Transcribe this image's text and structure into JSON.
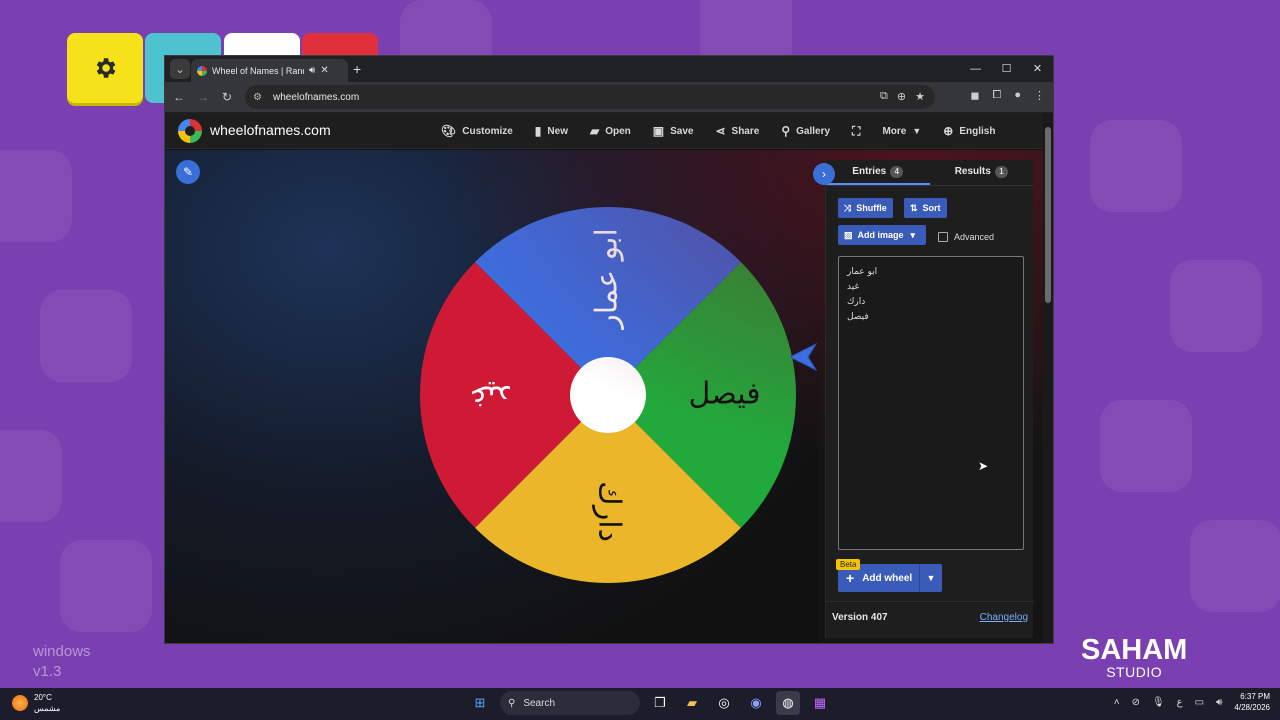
{
  "desktop": {
    "watermark_line1": "windows",
    "watermark_line2": "v1.3",
    "brand_title": "SAHAM",
    "brand_sub": "STUDIO"
  },
  "browser": {
    "tab_title": "Wheel of Names | Random",
    "url": "wheelofnames.com"
  },
  "site": {
    "logo_text": "wheelofnames.com",
    "nav": [
      {
        "label": "Customize",
        "icon": "palette-icon"
      },
      {
        "label": "New",
        "icon": "file-icon"
      },
      {
        "label": "Open",
        "icon": "folder-icon"
      },
      {
        "label": "Save",
        "icon": "save-icon"
      },
      {
        "label": "Share",
        "icon": "share-icon"
      },
      {
        "label": "Gallery",
        "icon": "search-icon"
      },
      {
        "label": "",
        "icon": "fullscreen-icon"
      },
      {
        "label": "More",
        "icon": "chevron-down-icon"
      },
      {
        "label": "English",
        "icon": "globe-icon"
      }
    ]
  },
  "wheel": {
    "segments": [
      {
        "label": "ابو عمار",
        "color": "#3d6ee0"
      },
      {
        "label": "غيد",
        "color": "#cf1a36"
      },
      {
        "label": "دارك",
        "color": "#ecb62a"
      },
      {
        "label": "فيصل",
        "color": "#22a93b"
      }
    ]
  },
  "panel": {
    "tab_entries": "Entries",
    "entries_count": "4",
    "tab_results": "Results",
    "results_count": "1",
    "shuffle": "Shuffle",
    "sort": "Sort",
    "add_image": "Add image",
    "advanced": "Advanced",
    "entries": [
      "ابو عمار",
      "غيد",
      "دارك",
      "فيصل"
    ],
    "beta": "Beta",
    "add_wheel": "Add wheel",
    "version": "Version 407",
    "changelog": "Changelog"
  },
  "taskbar": {
    "temp": "20°C",
    "weather_desc": "مشمس",
    "search": "Search",
    "lang": "ع",
    "time": "6:37 PM",
    "date": "4/28/2026"
  },
  "colors": {
    "desktop": "#7a3fb0",
    "accent_blue": "#3a5bb8",
    "link": "#7aaefb"
  }
}
